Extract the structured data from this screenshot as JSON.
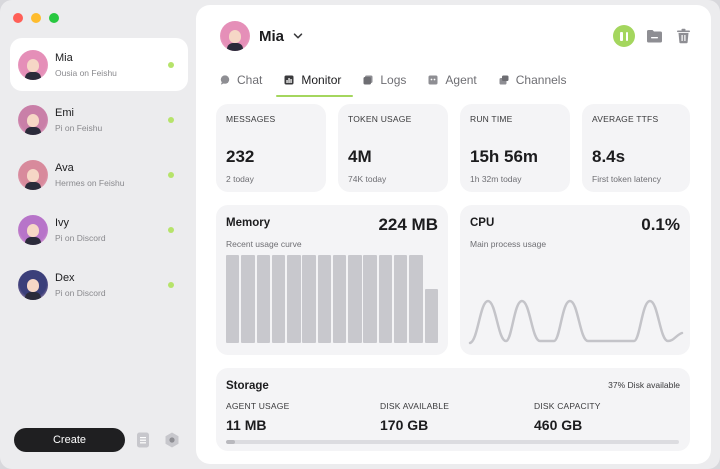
{
  "sidebar": {
    "agents": [
      {
        "name": "Mia",
        "sub": "Ousia on Feishu",
        "selected": true,
        "hair": "#e58fb8",
        "status": "online"
      },
      {
        "name": "Emi",
        "sub": "Pi on Feishu",
        "selected": false,
        "hair": "#c97fa8",
        "status": "online"
      },
      {
        "name": "Ava",
        "sub": "Hermes on Feishu",
        "selected": false,
        "hair": "#d88a9c",
        "status": "online"
      },
      {
        "name": "Ivy",
        "sub": "Pi on Discord",
        "selected": false,
        "hair": "#b774c9",
        "status": "online"
      },
      {
        "name": "Dex",
        "sub": "Pi on Discord",
        "selected": false,
        "hair": "#3b3f7a",
        "status": "online"
      }
    ],
    "create_label": "Create",
    "status_color": "#b6e36a"
  },
  "header": {
    "name": "Mia",
    "accent": "#a4d65e"
  },
  "tabs": [
    {
      "label": "Chat",
      "icon": "chat-icon",
      "active": false
    },
    {
      "label": "Monitor",
      "icon": "monitor-icon",
      "active": true
    },
    {
      "label": "Logs",
      "icon": "logs-icon",
      "active": false
    },
    {
      "label": "Agent",
      "icon": "agent-icon",
      "active": false
    },
    {
      "label": "Channels",
      "icon": "channels-icon",
      "active": false
    }
  ],
  "stats": [
    {
      "label": "MESSAGES",
      "value": "232",
      "sub": "2 today"
    },
    {
      "label": "TOKEN USAGE",
      "value": "4M",
      "sub": "74K today"
    },
    {
      "label": "RUN TIME",
      "value": "15h 56m",
      "sub": "1h 32m today"
    },
    {
      "label": "AVERAGE TTFS",
      "value": "8.4s",
      "sub": "First token latency"
    }
  ],
  "memory": {
    "title": "Memory",
    "value": "224 MB",
    "sub": "Recent usage curve",
    "bar_levels": [
      0.98,
      0.98,
      0.98,
      0.98,
      0.98,
      0.98,
      0.98,
      0.98,
      0.98,
      0.98,
      0.98,
      0.98,
      0.98,
      0.6
    ]
  },
  "cpu": {
    "title": "CPU",
    "value": "0.1%",
    "sub": "Main process usage"
  },
  "storage": {
    "title": "Storage",
    "note": "37% Disk available",
    "columns": [
      {
        "label": "AGENT USAGE",
        "value": "11 MB"
      },
      {
        "label": "DISK AVAILABLE",
        "value": "170 GB"
      },
      {
        "label": "DISK CAPACITY",
        "value": "460 GB"
      }
    ],
    "usage_fraction": 0.02
  }
}
